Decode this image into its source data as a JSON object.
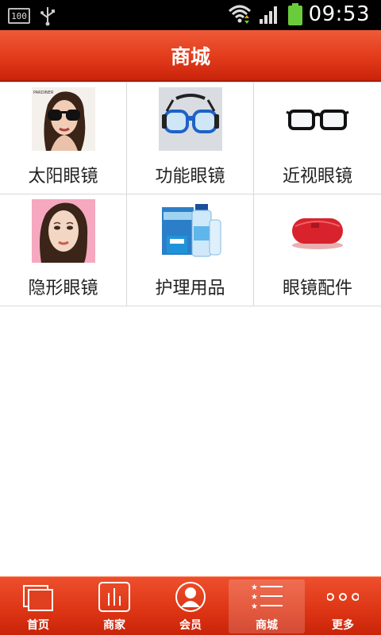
{
  "status": {
    "battery_small": "100",
    "time": "09:53"
  },
  "header": {
    "title": "商城"
  },
  "categories": [
    {
      "label": "太阳眼镜",
      "image": "sunglasses-model"
    },
    {
      "label": "功能眼镜",
      "image": "sports-goggles"
    },
    {
      "label": "近视眼镜",
      "image": "black-frame-glasses"
    },
    {
      "label": "隐形眼镜",
      "image": "contact-lens-model"
    },
    {
      "label": "护理用品",
      "image": "lens-care-solution"
    },
    {
      "label": "眼镜配件",
      "image": "red-glasses-case"
    }
  ],
  "nav": {
    "items": [
      {
        "label": "首页",
        "icon": "home-icon"
      },
      {
        "label": "商家",
        "icon": "merchant-icon"
      },
      {
        "label": "会员",
        "icon": "member-icon"
      },
      {
        "label": "商城",
        "icon": "mall-list-icon",
        "active": true
      },
      {
        "label": "更多",
        "icon": "more-dots-icon"
      }
    ]
  },
  "colors": {
    "accent": "#e23b1b",
    "status_bar": "#000000",
    "battery": "#6bcc3b"
  }
}
